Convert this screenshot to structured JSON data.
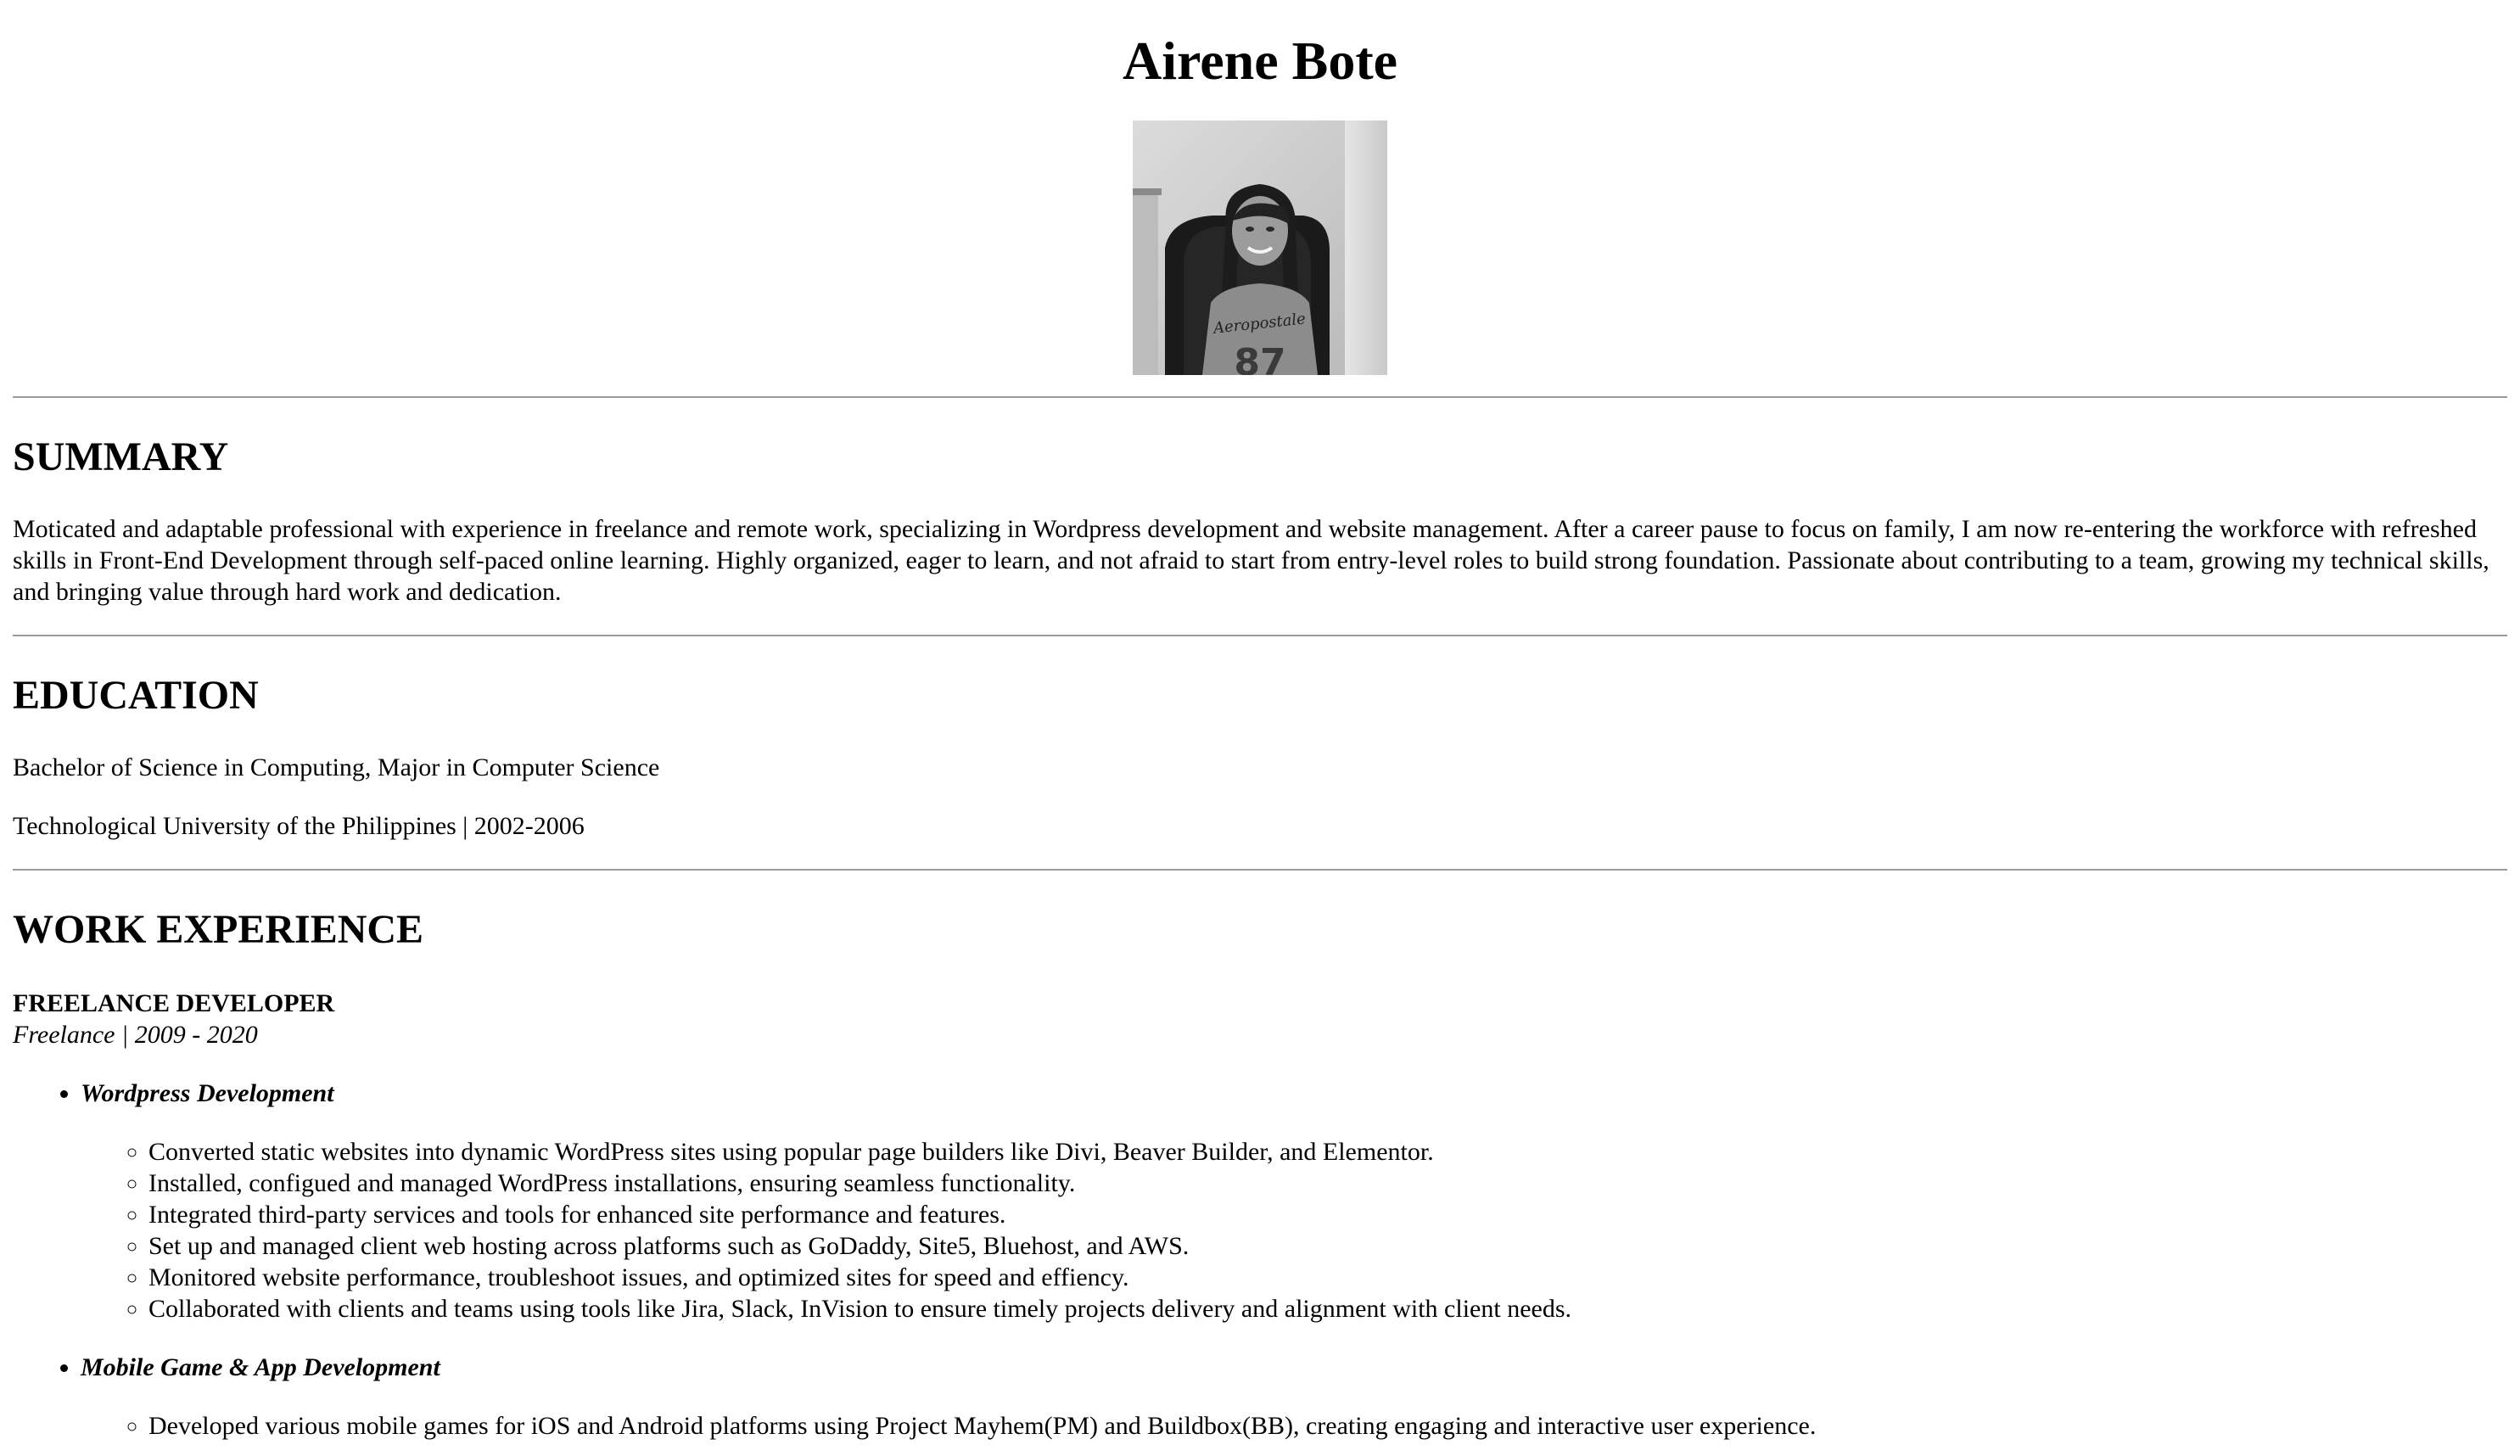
{
  "header": {
    "name": "Airene Bote",
    "photo_alt": "Portrait photo"
  },
  "summary": {
    "title": "SUMMARY",
    "text": "Moticated and adaptable professional with experience in freelance and remote work, specializing in Wordpress development and website management. After a career pause to focus on family, I am now re-entering the workforce with refreshed skills in Front-End Development through self-paced online learning. Highly organized, eager to learn, and not afraid to start from entry-level roles to build strong foundation. Passionate about contributing to a team, growing my technical skills, and bringing value through hard work and dedication."
  },
  "education": {
    "title": "EDUCATION",
    "degree": "Bachelor of Science in Computing, Major in Computer Science",
    "school": "Technological University of the Philippines | 2002-2006"
  },
  "work": {
    "title": "WORK EXPERIENCE",
    "jobs": [
      {
        "title": "FREELANCE DEVELOPER",
        "meta": "Freelance | 2009 - 2020",
        "skills": [
          {
            "name": "Wordpress Development",
            "tasks": [
              "Converted static websites into dynamic WordPress sites using popular page builders like Divi, Beaver Builder, and Elementor.",
              "Installed, configued and managed WordPress installations, ensuring seamless functionality.",
              "Integrated third-party services and tools for enhanced site performance and features.",
              "Set up and managed client web hosting across platforms such as GoDaddy, Site5, Bluehost, and AWS.",
              "Monitored website performance, troubleshoot issues, and optimized sites for speed and effiency.",
              "Collaborated with clients and teams using tools like Jira, Slack, InVision to ensure timely projects delivery and alignment with client needs."
            ]
          },
          {
            "name": "Mobile Game & App Development",
            "tasks": [
              "Developed various mobile games for iOS and Android platforms using Project Mayhem(PM) and Buildbox(BB), creating engaging and interactive user experience."
            ]
          }
        ]
      }
    ]
  },
  "photo_shirt_text": "Aeropostale",
  "photo_shirt_number": "87"
}
